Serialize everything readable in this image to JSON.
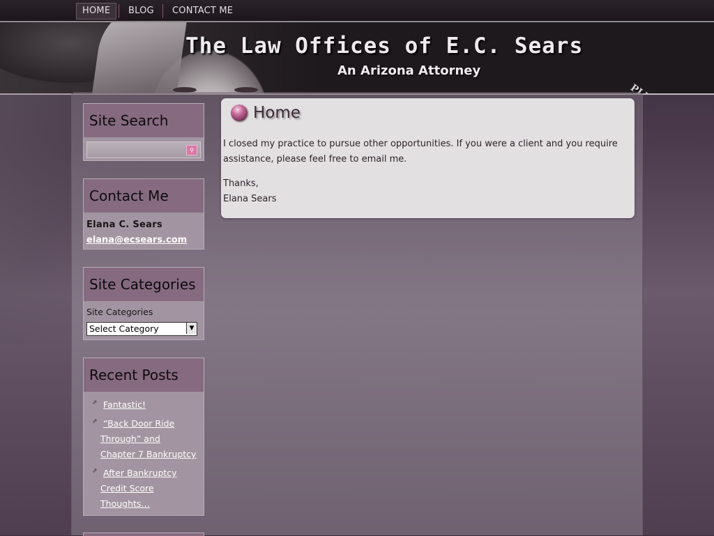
{
  "nav": {
    "items": [
      {
        "label": "HOME",
        "active": true
      },
      {
        "label": "BLOG",
        "active": false
      },
      {
        "label": "CONTACT ME",
        "active": false
      }
    ]
  },
  "header": {
    "title": "The Law Offices of E.C. Sears",
    "subtitle": "An Arizona Attorney",
    "suffix": "PLLC."
  },
  "sidebar": {
    "search": {
      "heading": "Site Search",
      "value": "",
      "button_icon": "search-icon"
    },
    "contact": {
      "heading": "Contact Me",
      "name": "Elana C. Sears",
      "email": "elana@ecsears.com"
    },
    "categories": {
      "heading": "Site Categories",
      "label": "Site Categories",
      "selected": "Select Category"
    },
    "recent_posts": {
      "heading": "Recent Posts",
      "items": [
        {
          "line1": "Fantastic!"
        },
        {
          "line1": "“Back Door Ride",
          "line2": "Through” and",
          "line3": "Chapter 7 Bankruptcy"
        },
        {
          "line1": "After Bankruptcy",
          "line2": "Credit Score",
          "line3": "Thoughts…"
        }
      ]
    }
  },
  "main": {
    "heading": "Home",
    "paragraph1_line1": "I closed my practice to pursue other opportunities. If you were a client and you require",
    "paragraph1_line2": "assistance, please feel free to email me.",
    "paragraph2_line1": "Thanks,",
    "paragraph2_line2": "Elana Sears"
  },
  "colors": {
    "accent": "#856a80",
    "content_bg": "#e3e0e2",
    "search_button": "#d77aa6"
  }
}
